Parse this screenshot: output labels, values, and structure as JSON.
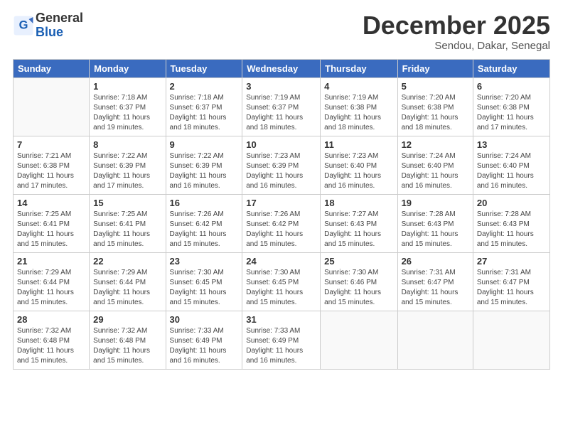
{
  "header": {
    "logo_general": "General",
    "logo_blue": "Blue",
    "month": "December 2025",
    "location": "Sendou, Dakar, Senegal"
  },
  "days_of_week": [
    "Sunday",
    "Monday",
    "Tuesday",
    "Wednesday",
    "Thursday",
    "Friday",
    "Saturday"
  ],
  "weeks": [
    [
      {
        "day": "",
        "info": ""
      },
      {
        "day": "1",
        "info": "Sunrise: 7:18 AM\nSunset: 6:37 PM\nDaylight: 11 hours\nand 19 minutes."
      },
      {
        "day": "2",
        "info": "Sunrise: 7:18 AM\nSunset: 6:37 PM\nDaylight: 11 hours\nand 18 minutes."
      },
      {
        "day": "3",
        "info": "Sunrise: 7:19 AM\nSunset: 6:37 PM\nDaylight: 11 hours\nand 18 minutes."
      },
      {
        "day": "4",
        "info": "Sunrise: 7:19 AM\nSunset: 6:38 PM\nDaylight: 11 hours\nand 18 minutes."
      },
      {
        "day": "5",
        "info": "Sunrise: 7:20 AM\nSunset: 6:38 PM\nDaylight: 11 hours\nand 18 minutes."
      },
      {
        "day": "6",
        "info": "Sunrise: 7:20 AM\nSunset: 6:38 PM\nDaylight: 11 hours\nand 17 minutes."
      }
    ],
    [
      {
        "day": "7",
        "info": "Sunrise: 7:21 AM\nSunset: 6:38 PM\nDaylight: 11 hours\nand 17 minutes."
      },
      {
        "day": "8",
        "info": "Sunrise: 7:22 AM\nSunset: 6:39 PM\nDaylight: 11 hours\nand 17 minutes."
      },
      {
        "day": "9",
        "info": "Sunrise: 7:22 AM\nSunset: 6:39 PM\nDaylight: 11 hours\nand 16 minutes."
      },
      {
        "day": "10",
        "info": "Sunrise: 7:23 AM\nSunset: 6:39 PM\nDaylight: 11 hours\nand 16 minutes."
      },
      {
        "day": "11",
        "info": "Sunrise: 7:23 AM\nSunset: 6:40 PM\nDaylight: 11 hours\nand 16 minutes."
      },
      {
        "day": "12",
        "info": "Sunrise: 7:24 AM\nSunset: 6:40 PM\nDaylight: 11 hours\nand 16 minutes."
      },
      {
        "day": "13",
        "info": "Sunrise: 7:24 AM\nSunset: 6:40 PM\nDaylight: 11 hours\nand 16 minutes."
      }
    ],
    [
      {
        "day": "14",
        "info": "Sunrise: 7:25 AM\nSunset: 6:41 PM\nDaylight: 11 hours\nand 15 minutes."
      },
      {
        "day": "15",
        "info": "Sunrise: 7:25 AM\nSunset: 6:41 PM\nDaylight: 11 hours\nand 15 minutes."
      },
      {
        "day": "16",
        "info": "Sunrise: 7:26 AM\nSunset: 6:42 PM\nDaylight: 11 hours\nand 15 minutes."
      },
      {
        "day": "17",
        "info": "Sunrise: 7:26 AM\nSunset: 6:42 PM\nDaylight: 11 hours\nand 15 minutes."
      },
      {
        "day": "18",
        "info": "Sunrise: 7:27 AM\nSunset: 6:43 PM\nDaylight: 11 hours\nand 15 minutes."
      },
      {
        "day": "19",
        "info": "Sunrise: 7:28 AM\nSunset: 6:43 PM\nDaylight: 11 hours\nand 15 minutes."
      },
      {
        "day": "20",
        "info": "Sunrise: 7:28 AM\nSunset: 6:43 PM\nDaylight: 11 hours\nand 15 minutes."
      }
    ],
    [
      {
        "day": "21",
        "info": "Sunrise: 7:29 AM\nSunset: 6:44 PM\nDaylight: 11 hours\nand 15 minutes."
      },
      {
        "day": "22",
        "info": "Sunrise: 7:29 AM\nSunset: 6:44 PM\nDaylight: 11 hours\nand 15 minutes."
      },
      {
        "day": "23",
        "info": "Sunrise: 7:30 AM\nSunset: 6:45 PM\nDaylight: 11 hours\nand 15 minutes."
      },
      {
        "day": "24",
        "info": "Sunrise: 7:30 AM\nSunset: 6:45 PM\nDaylight: 11 hours\nand 15 minutes."
      },
      {
        "day": "25",
        "info": "Sunrise: 7:30 AM\nSunset: 6:46 PM\nDaylight: 11 hours\nand 15 minutes."
      },
      {
        "day": "26",
        "info": "Sunrise: 7:31 AM\nSunset: 6:47 PM\nDaylight: 11 hours\nand 15 minutes."
      },
      {
        "day": "27",
        "info": "Sunrise: 7:31 AM\nSunset: 6:47 PM\nDaylight: 11 hours\nand 15 minutes."
      }
    ],
    [
      {
        "day": "28",
        "info": "Sunrise: 7:32 AM\nSunset: 6:48 PM\nDaylight: 11 hours\nand 15 minutes."
      },
      {
        "day": "29",
        "info": "Sunrise: 7:32 AM\nSunset: 6:48 PM\nDaylight: 11 hours\nand 15 minutes."
      },
      {
        "day": "30",
        "info": "Sunrise: 7:33 AM\nSunset: 6:49 PM\nDaylight: 11 hours\nand 16 minutes."
      },
      {
        "day": "31",
        "info": "Sunrise: 7:33 AM\nSunset: 6:49 PM\nDaylight: 11 hours\nand 16 minutes."
      },
      {
        "day": "",
        "info": ""
      },
      {
        "day": "",
        "info": ""
      },
      {
        "day": "",
        "info": ""
      }
    ]
  ]
}
